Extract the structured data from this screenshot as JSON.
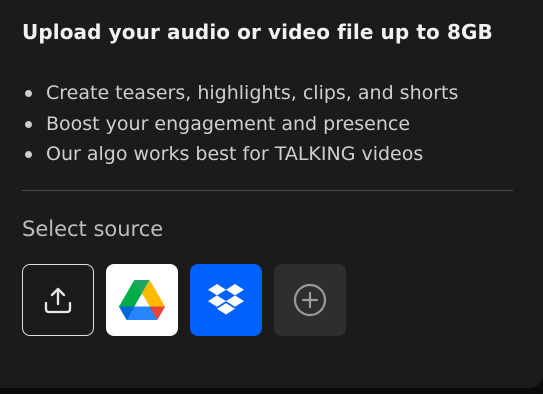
{
  "panel": {
    "title": "Upload your audio or video file up to 8GB",
    "features": [
      "Create teasers, highlights, clips, and shorts",
      "Boost your engagement and presence",
      "Our algo works best for TALKING videos"
    ],
    "source_label": "Select source"
  },
  "sources": [
    {
      "name": "upload",
      "icon": "upload-icon"
    },
    {
      "name": "google-drive",
      "icon": "google-drive-icon"
    },
    {
      "name": "dropbox",
      "icon": "dropbox-icon"
    },
    {
      "name": "more",
      "icon": "plus-circle-icon"
    }
  ],
  "colors": {
    "panel_background": "#1b1b1b",
    "dropbox_blue": "#0061fe",
    "title_text": "#f2f2f2",
    "body_text": "#cfcfcf"
  }
}
